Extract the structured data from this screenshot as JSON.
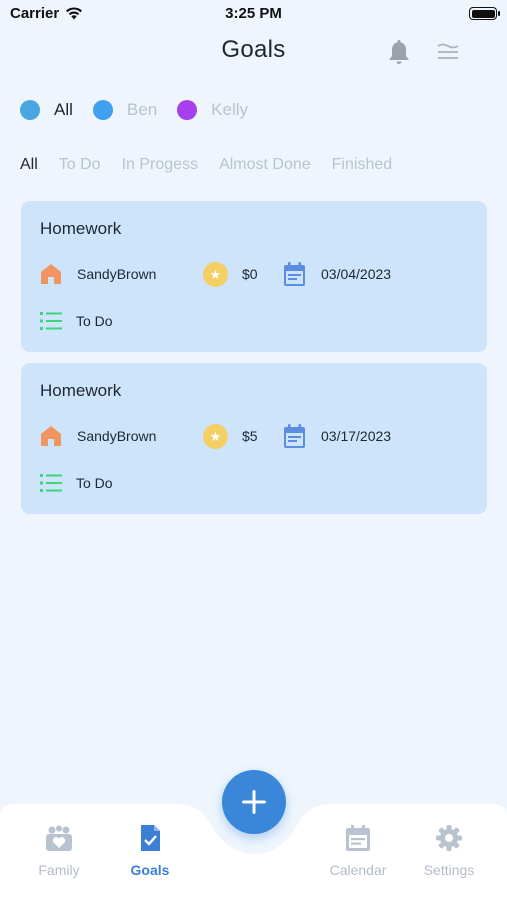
{
  "status_bar": {
    "carrier": "Carrier",
    "time": "3:25 PM"
  },
  "header": {
    "title": "Goals"
  },
  "people": [
    {
      "name": "All",
      "color": "#4aa6e0",
      "active": true
    },
    {
      "name": "Ben",
      "color": "#3ea0ef",
      "active": false
    },
    {
      "name": "Kelly",
      "color": "#a63fee",
      "active": false
    }
  ],
  "status_tabs": [
    "All",
    "To Do",
    "In Progess",
    "Almost Done",
    "Finished"
  ],
  "goals": [
    {
      "title": "Homework",
      "owner": "SandyBrown",
      "reward": "$0",
      "due_date": "03/04/2023",
      "status": "To Do"
    },
    {
      "title": "Homework",
      "owner": "SandyBrown",
      "reward": "$5",
      "due_date": "03/17/2023",
      "status": "To Do"
    }
  ],
  "tab_bar": {
    "items": [
      {
        "label": "Family",
        "icon": "family-icon",
        "active": false
      },
      {
        "label": "Goals",
        "icon": "goals-icon",
        "active": true
      },
      {
        "label": "Calendar",
        "icon": "calendar-icon",
        "active": false
      },
      {
        "label": "Settings",
        "icon": "settings-icon",
        "active": false
      }
    ],
    "fab_icon": "plus-icon"
  },
  "colors": {
    "background": "#eef5fd",
    "card": "#cde4fa",
    "accent": "#3a86d9",
    "home_icon": "#f0955f",
    "coin_icon": "#f4cf64",
    "calendar_icon": "#5b8ee0",
    "list_icon": "#3bd67a"
  }
}
